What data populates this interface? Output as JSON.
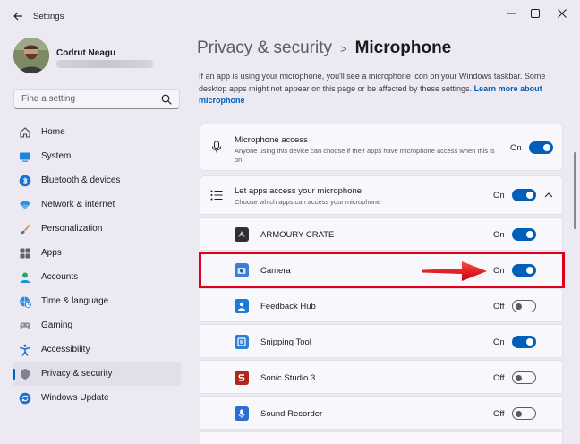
{
  "window": {
    "title": "Settings",
    "icons": {
      "back": "back-arrow-icon",
      "minimize": "minimize-icon",
      "maximize": "maximize-icon",
      "close": "close-icon"
    }
  },
  "user": {
    "name": "Codrut Neagu"
  },
  "search": {
    "placeholder": "Find a setting",
    "icon": "search-icon"
  },
  "nav": [
    {
      "label": "Home",
      "icon": "home-icon"
    },
    {
      "label": "System",
      "icon": "system-icon"
    },
    {
      "label": "Bluetooth & devices",
      "icon": "bluetooth-icon"
    },
    {
      "label": "Network & internet",
      "icon": "wifi-icon"
    },
    {
      "label": "Personalization",
      "icon": "brush-icon"
    },
    {
      "label": "Apps",
      "icon": "apps-icon"
    },
    {
      "label": "Accounts",
      "icon": "accounts-icon"
    },
    {
      "label": "Time & language",
      "icon": "globe-clock-icon"
    },
    {
      "label": "Gaming",
      "icon": "gamepad-icon"
    },
    {
      "label": "Accessibility",
      "icon": "accessibility-icon"
    },
    {
      "label": "Privacy & security",
      "icon": "shield-icon",
      "active": true
    },
    {
      "label": "Windows Update",
      "icon": "update-icon"
    }
  ],
  "breadcrumb": {
    "parent": "Privacy & security",
    "separator": ">",
    "current": "Microphone"
  },
  "intro": {
    "text": "If an app is using your microphone, you'll see a microphone icon on your Windows taskbar. Some desktop apps might not appear on this page or be affected by these settings.",
    "link": "Learn more about microphone"
  },
  "microphone_access": {
    "title": "Microphone access",
    "description": "Anyone using this device can choose if their apps have microphone access when this is on",
    "state": "On",
    "icon": "microphone-icon"
  },
  "apps_access": {
    "title": "Let apps access your microphone",
    "description": "Choose which apps can access your microphone",
    "state": "On",
    "icon": "list-icon",
    "chevron": "chevron-up-icon"
  },
  "apps": [
    {
      "name": "ARMOURY CRATE",
      "state": "On",
      "icon": "armoury-crate-icon"
    },
    {
      "name": "Camera",
      "state": "On",
      "icon": "camera-icon"
    },
    {
      "name": "Feedback Hub",
      "state": "Off",
      "icon": "feedback-hub-icon"
    },
    {
      "name": "Snipping Tool",
      "state": "On",
      "icon": "snipping-tool-icon"
    },
    {
      "name": "Sonic Studio 3",
      "state": "Off",
      "icon": "sonic-studio-icon"
    },
    {
      "name": "Sound Recorder",
      "state": "Off",
      "icon": "sound-recorder-icon"
    }
  ],
  "annotation": {
    "highlight_color": "#e0001b",
    "arrow_color": "#e0001b"
  },
  "colors": {
    "accent": "#005fb8",
    "background": "#ece9f3"
  }
}
